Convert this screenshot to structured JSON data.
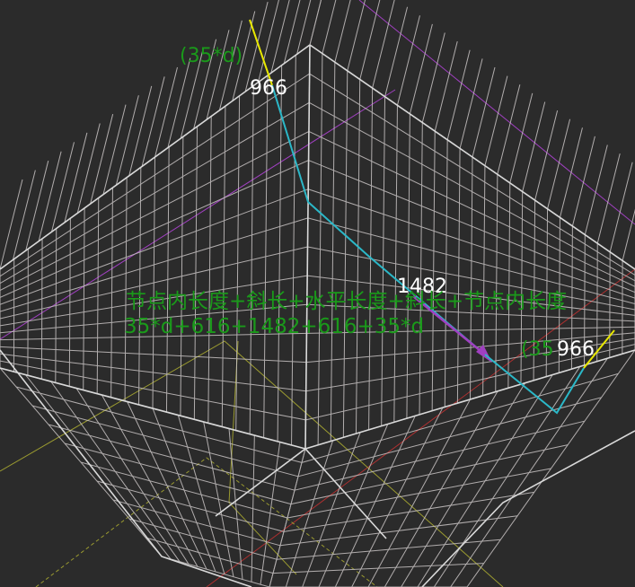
{
  "scene": {
    "background": "#2b2b2b",
    "colors": {
      "grid": "#c9c4c4",
      "rebar_cyan": "#2bb8c8",
      "rebar_yellow": "#e8e800",
      "accent_magenta": "#a040c0",
      "axis_red": "#b03030",
      "aux_yellow": "#9a9a30",
      "annotation_green": "#1a9a1a"
    }
  },
  "labels": {
    "left_anchor": "(35*d)",
    "left_length": "966",
    "mid_length": "1482",
    "formula_line1": "节点内长度+斜长+水平长度+斜长+节点内长度",
    "formula_line2": "35*d+616+1482+616+35*d",
    "right_anchor": "(35",
    "right_length": "966"
  }
}
